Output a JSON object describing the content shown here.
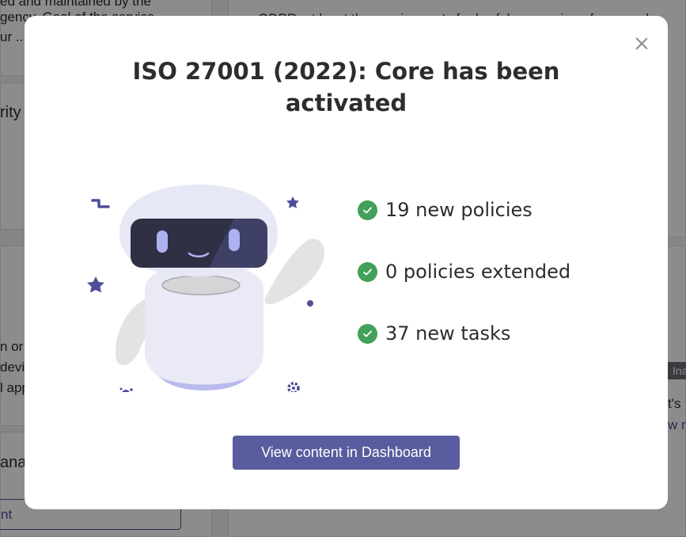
{
  "background": {
    "snippet_top_left_1": "ed and maintained by the",
    "snippet_top_left_2": "gency. Goal of the service",
    "snippet_top_left_3": "ur ...",
    "snippet_top_right": "GDPR, at least the requirements for lawful processing of personal",
    "snippet_priority": "rity",
    "snippet_device_1": "n or",
    "snippet_device_2": "devic",
    "snippet_device_3": "l app",
    "snippet_manage": "anag",
    "snippet_button": "nt",
    "badge": "Ina",
    "snippet_right_1": "t's",
    "snippet_right_link": "w m"
  },
  "modal": {
    "title": "ISO 27001 (2022): Core has been activated",
    "close_icon": "close-icon",
    "stats": [
      {
        "icon": "check-circle-icon",
        "label": "19 new policies"
      },
      {
        "icon": "check-circle-icon",
        "label": "0 policies extended"
      },
      {
        "icon": "check-circle-icon",
        "label": "37 new tasks"
      }
    ],
    "cta_label": "View content in Dashboard"
  },
  "colors": {
    "accent": "#595c9e",
    "success": "#43a05a",
    "robot_body": "#e6e7f5",
    "robot_visor": "#2f3043",
    "decor": "#4c4f96"
  }
}
